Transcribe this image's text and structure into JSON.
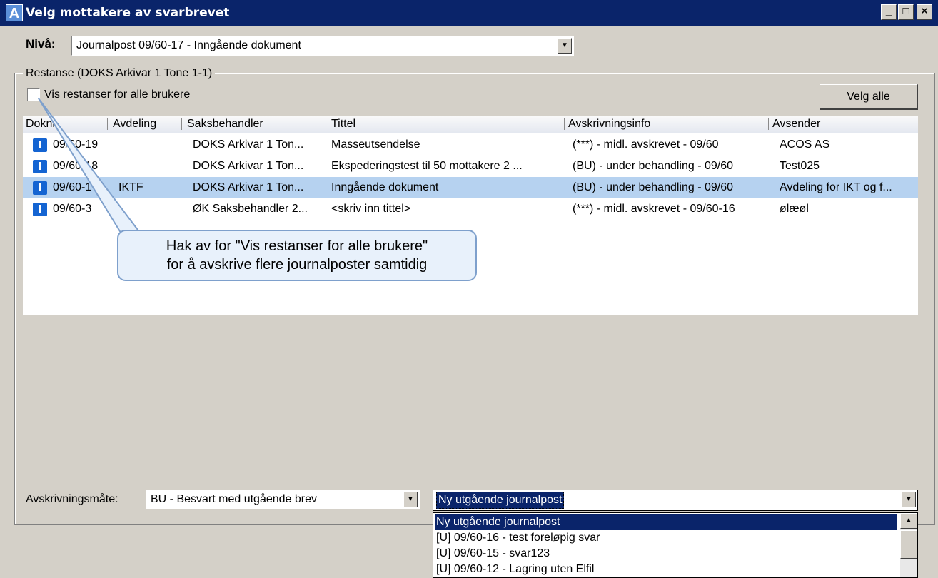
{
  "window": {
    "title": "Velg mottakere av svarbrevet",
    "app_icon": "A",
    "controls": {
      "minimize": "_",
      "maximize": "□",
      "close": "×"
    }
  },
  "toolbar": {
    "niva_label": "Nivå:",
    "niva_value": "Journalpost 09/60-17 - Inngående dokument"
  },
  "restanse": {
    "group_title": "Restanse (DOKS Arkivar 1 Tone 1-1)",
    "show_all_label": "Vis restanser for alle brukere",
    "show_all_checked": false,
    "select_all_label": "Velg alle",
    "columns": [
      "Doknr",
      "Avdeling",
      "Saksbehandler",
      "Tittel",
      "Avskrivningsinfo",
      "Avsender"
    ],
    "rows": [
      {
        "icon": "I",
        "doknr": "09/60-19",
        "avdeling": "",
        "saksbehandler": "DOKS Arkivar 1 Ton...",
        "tittel": "Masseutsendelse",
        "avskrivningsinfo": "(***) - midl. avskrevet - 09/60",
        "avsender": "ACOS AS",
        "selected": false
      },
      {
        "icon": "I",
        "doknr": "09/60-18",
        "avdeling": "",
        "saksbehandler": "DOKS Arkivar 1 Ton...",
        "tittel": "Ekspederingstest til 50 mottakere 2 ...",
        "avskrivningsinfo": "(BU) - under behandling - 09/60",
        "avsender": "Test025",
        "selected": false
      },
      {
        "icon": "I",
        "doknr": "09/60-17",
        "avdeling": "IKTF",
        "saksbehandler": "DOKS Arkivar 1 Ton...",
        "tittel": "Inngående dokument",
        "avskrivningsinfo": "(BU) - under behandling - 09/60",
        "avsender": "Avdeling for IKT og f...",
        "selected": true
      },
      {
        "icon": "I",
        "doknr": "09/60-3",
        "avdeling": "",
        "saksbehandler": "ØK Saksbehandler 2...",
        "tittel": "<skriv inn tittel>",
        "avskrivningsinfo": "(***) - midl. avskrevet - 09/60-16",
        "avsender": "ølæøl",
        "selected": false
      }
    ]
  },
  "callout": {
    "line1": "Hak av for \"Vis restanser for alle brukere\"",
    "line2": "for å avskrive flere journalposter samtidig"
  },
  "avskrivning": {
    "label": "Avskrivningsmåte:",
    "mode_value": "BU - Besvart med utgående brev",
    "target_value": "Ny utgående journalpost",
    "options": [
      "Ny utgående journalpost",
      "[U] 09/60-16 - test foreløpig svar",
      "[U] 09/60-15 - svar123",
      "[U] 09/60-12 - Lagring uten Elfil"
    ]
  },
  "colors": {
    "titlebar": "#0a246a",
    "selection": "#b6d2f0",
    "dropdown_selection": "#0a246a",
    "callout_bg": "#e8f1fb",
    "icon_blue": "#1464d2"
  },
  "icons": {
    "row_icon": "incoming-document-icon",
    "checkbox": "checkbox-icon",
    "dropdown": "chevron-down-icon"
  }
}
